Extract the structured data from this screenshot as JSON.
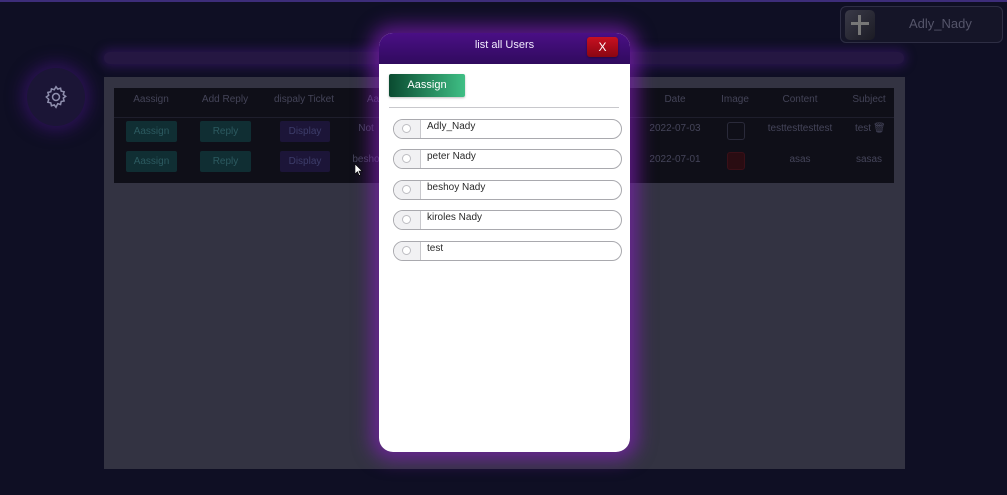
{
  "user": {
    "name": "Adly_Nady",
    "avatar_icon": "user-avatar"
  },
  "sidebar": {
    "icon": "gear-icon"
  },
  "table": {
    "headers": [
      "Aassign",
      "Add Reply",
      "dispaly Ticket",
      "Aa",
      "Date",
      "Image",
      "Content",
      "Subject"
    ],
    "rows": [
      {
        "assign_label": "Aassign",
        "reply_label": "Reply",
        "display_label": "Display",
        "col4": "Not",
        "date": "2022-07-03",
        "content": "testtesttesttest",
        "subject": "test"
      },
      {
        "assign_label": "Aassign",
        "reply_label": "Reply",
        "display_label": "Display",
        "col4": "besho",
        "date": "2022-07-01",
        "content": "asas",
        "subject": "sasas"
      }
    ]
  },
  "modal": {
    "title": "list all Users",
    "close_label": "X",
    "assign_label": "Aassign",
    "users": [
      "Adly_Nady",
      "peter Nady",
      "beshoy Nady",
      "kiroles Nady",
      "test"
    ]
  },
  "colors": {
    "modal_header": "#4a0f85",
    "close_button": "#c81020",
    "assign_button": "#3fbf85",
    "background": "#0f0f24"
  }
}
